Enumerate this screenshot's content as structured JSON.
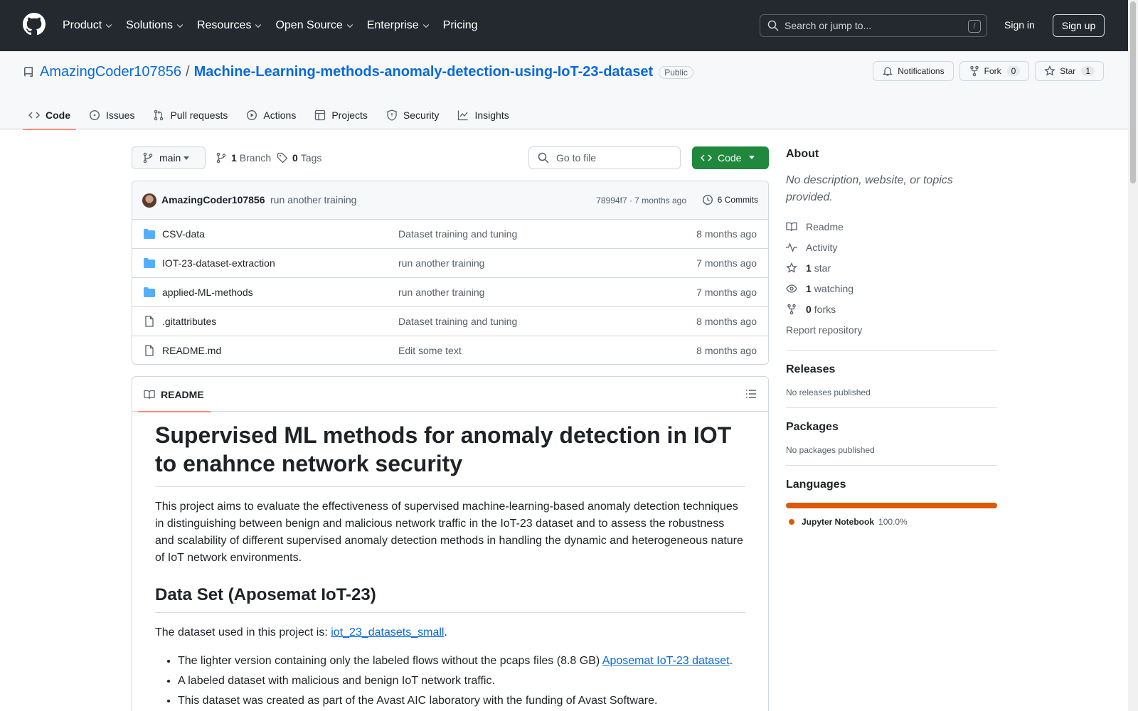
{
  "header": {
    "nav": [
      "Product",
      "Solutions",
      "Resources",
      "Open Source",
      "Enterprise",
      "Pricing"
    ],
    "search_placeholder": "Search or jump to...",
    "search_shortcut": "/",
    "signin": "Sign in",
    "signup": "Sign up"
  },
  "repo": {
    "owner": "AmazingCoder107856",
    "separator": "/",
    "name": "Machine-Learning-methods-anomaly-detection-using-IoT-23-dataset",
    "visibility": "Public",
    "notifications": "Notifications",
    "fork_label": "Fork",
    "fork_count": "0",
    "star_label": "Star",
    "star_count": "1",
    "tabs": [
      "Code",
      "Issues",
      "Pull requests",
      "Actions",
      "Projects",
      "Security",
      "Insights"
    ]
  },
  "toolbar": {
    "branch": "main",
    "branch_count": "1",
    "branch_label": "Branch",
    "tag_count": "0",
    "tag_label": "Tags",
    "goto_placeholder": "Go to file",
    "code_label": "Code"
  },
  "commit": {
    "author": "AmazingCoder107856",
    "message": "run another training",
    "hash_time": "78994f7 · 7 months ago",
    "count": "6 Commits"
  },
  "files": [
    {
      "name": "CSV-data",
      "message": "Dataset training and tuning",
      "age": "8 months ago",
      "type": "folder"
    },
    {
      "name": "IOT-23-dataset-extraction",
      "message": "run another training",
      "age": "7 months ago",
      "type": "folder"
    },
    {
      "name": "applied-ML-methods",
      "message": "run another training",
      "age": "7 months ago",
      "type": "folder"
    },
    {
      "name": ".gitattributes",
      "message": "Dataset training and tuning",
      "age": "8 months ago",
      "type": "file"
    },
    {
      "name": "README.md",
      "message": "Edit some text",
      "age": "8 months ago",
      "type": "file"
    }
  ],
  "readme": {
    "tab": "README",
    "h1": "Supervised ML methods for anomaly detection in IOT to enahnce network security",
    "intro": "This project aims to evaluate the effectiveness of supervised machine-learning-based anomaly detection techniques in distinguishing between benign and malicious network traffic in the IoT-23 dataset and to assess the robustness and scalability of different supervised anomaly detection methods in handling the dynamic and heterogeneous nature of IoT network environments.",
    "h2": "Data Set (Aposemat IoT-23)",
    "dataset_prefix": "The dataset used in this project is: ",
    "dataset_link": "iot_23_datasets_small",
    "dataset_suffix": ".",
    "bullet1_prefix": "The lighter version containing only the labeled flows without the pcaps files (8.8 GB) ",
    "bullet1_link": "Aposemat IoT-23 dataset",
    "bullet1_suffix": ".",
    "bullet2": "A labeled dataset with malicious and benign IoT network traffic.",
    "bullet3": "This dataset was created as part of the Avast AIC laboratory with the funding of Avast Software."
  },
  "sidebar": {
    "about_title": "About",
    "description": "No description, website, or topics provided.",
    "readme": "Readme",
    "activity": "Activity",
    "stars_count": "1",
    "stars_label": "star",
    "watching_count": "1",
    "watching_label": "watching",
    "forks_count": "0",
    "forks_label": "forks",
    "report": "Report repository",
    "releases_title": "Releases",
    "releases_none": "No releases published",
    "packages_title": "Packages",
    "packages_none": "No packages published",
    "languages_title": "Languages",
    "language": "Jupyter Notebook",
    "language_pct": "100.0%",
    "language_color": "#da5b0b"
  },
  "colors": {
    "header_bg": "#24292f",
    "link": "#0969da",
    "primary_button": "#1f883d",
    "active_tab_underline": "#fd8c73"
  }
}
